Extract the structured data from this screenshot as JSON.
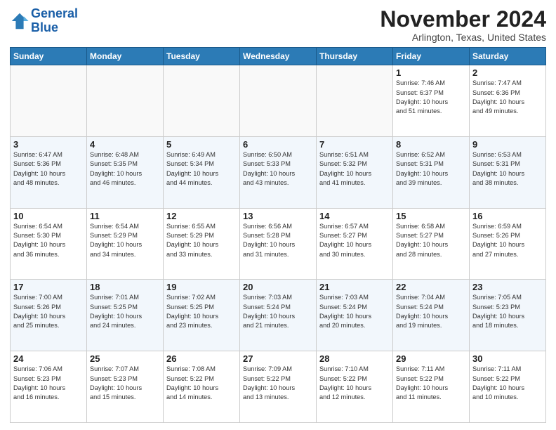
{
  "logo": {
    "line1": "General",
    "line2": "Blue"
  },
  "title": "November 2024",
  "location": "Arlington, Texas, United States",
  "weekdays": [
    "Sunday",
    "Monday",
    "Tuesday",
    "Wednesday",
    "Thursday",
    "Friday",
    "Saturday"
  ],
  "weeks": [
    [
      {
        "day": "",
        "info": ""
      },
      {
        "day": "",
        "info": ""
      },
      {
        "day": "",
        "info": ""
      },
      {
        "day": "",
        "info": ""
      },
      {
        "day": "",
        "info": ""
      },
      {
        "day": "1",
        "info": "Sunrise: 7:46 AM\nSunset: 6:37 PM\nDaylight: 10 hours\nand 51 minutes."
      },
      {
        "day": "2",
        "info": "Sunrise: 7:47 AM\nSunset: 6:36 PM\nDaylight: 10 hours\nand 49 minutes."
      }
    ],
    [
      {
        "day": "3",
        "info": "Sunrise: 6:47 AM\nSunset: 5:36 PM\nDaylight: 10 hours\nand 48 minutes."
      },
      {
        "day": "4",
        "info": "Sunrise: 6:48 AM\nSunset: 5:35 PM\nDaylight: 10 hours\nand 46 minutes."
      },
      {
        "day": "5",
        "info": "Sunrise: 6:49 AM\nSunset: 5:34 PM\nDaylight: 10 hours\nand 44 minutes."
      },
      {
        "day": "6",
        "info": "Sunrise: 6:50 AM\nSunset: 5:33 PM\nDaylight: 10 hours\nand 43 minutes."
      },
      {
        "day": "7",
        "info": "Sunrise: 6:51 AM\nSunset: 5:32 PM\nDaylight: 10 hours\nand 41 minutes."
      },
      {
        "day": "8",
        "info": "Sunrise: 6:52 AM\nSunset: 5:31 PM\nDaylight: 10 hours\nand 39 minutes."
      },
      {
        "day": "9",
        "info": "Sunrise: 6:53 AM\nSunset: 5:31 PM\nDaylight: 10 hours\nand 38 minutes."
      }
    ],
    [
      {
        "day": "10",
        "info": "Sunrise: 6:54 AM\nSunset: 5:30 PM\nDaylight: 10 hours\nand 36 minutes."
      },
      {
        "day": "11",
        "info": "Sunrise: 6:54 AM\nSunset: 5:29 PM\nDaylight: 10 hours\nand 34 minutes."
      },
      {
        "day": "12",
        "info": "Sunrise: 6:55 AM\nSunset: 5:29 PM\nDaylight: 10 hours\nand 33 minutes."
      },
      {
        "day": "13",
        "info": "Sunrise: 6:56 AM\nSunset: 5:28 PM\nDaylight: 10 hours\nand 31 minutes."
      },
      {
        "day": "14",
        "info": "Sunrise: 6:57 AM\nSunset: 5:27 PM\nDaylight: 10 hours\nand 30 minutes."
      },
      {
        "day": "15",
        "info": "Sunrise: 6:58 AM\nSunset: 5:27 PM\nDaylight: 10 hours\nand 28 minutes."
      },
      {
        "day": "16",
        "info": "Sunrise: 6:59 AM\nSunset: 5:26 PM\nDaylight: 10 hours\nand 27 minutes."
      }
    ],
    [
      {
        "day": "17",
        "info": "Sunrise: 7:00 AM\nSunset: 5:26 PM\nDaylight: 10 hours\nand 25 minutes."
      },
      {
        "day": "18",
        "info": "Sunrise: 7:01 AM\nSunset: 5:25 PM\nDaylight: 10 hours\nand 24 minutes."
      },
      {
        "day": "19",
        "info": "Sunrise: 7:02 AM\nSunset: 5:25 PM\nDaylight: 10 hours\nand 23 minutes."
      },
      {
        "day": "20",
        "info": "Sunrise: 7:03 AM\nSunset: 5:24 PM\nDaylight: 10 hours\nand 21 minutes."
      },
      {
        "day": "21",
        "info": "Sunrise: 7:03 AM\nSunset: 5:24 PM\nDaylight: 10 hours\nand 20 minutes."
      },
      {
        "day": "22",
        "info": "Sunrise: 7:04 AM\nSunset: 5:24 PM\nDaylight: 10 hours\nand 19 minutes."
      },
      {
        "day": "23",
        "info": "Sunrise: 7:05 AM\nSunset: 5:23 PM\nDaylight: 10 hours\nand 18 minutes."
      }
    ],
    [
      {
        "day": "24",
        "info": "Sunrise: 7:06 AM\nSunset: 5:23 PM\nDaylight: 10 hours\nand 16 minutes."
      },
      {
        "day": "25",
        "info": "Sunrise: 7:07 AM\nSunset: 5:23 PM\nDaylight: 10 hours\nand 15 minutes."
      },
      {
        "day": "26",
        "info": "Sunrise: 7:08 AM\nSunset: 5:22 PM\nDaylight: 10 hours\nand 14 minutes."
      },
      {
        "day": "27",
        "info": "Sunrise: 7:09 AM\nSunset: 5:22 PM\nDaylight: 10 hours\nand 13 minutes."
      },
      {
        "day": "28",
        "info": "Sunrise: 7:10 AM\nSunset: 5:22 PM\nDaylight: 10 hours\nand 12 minutes."
      },
      {
        "day": "29",
        "info": "Sunrise: 7:11 AM\nSunset: 5:22 PM\nDaylight: 10 hours\nand 11 minutes."
      },
      {
        "day": "30",
        "info": "Sunrise: 7:11 AM\nSunset: 5:22 PM\nDaylight: 10 hours\nand 10 minutes."
      }
    ]
  ]
}
